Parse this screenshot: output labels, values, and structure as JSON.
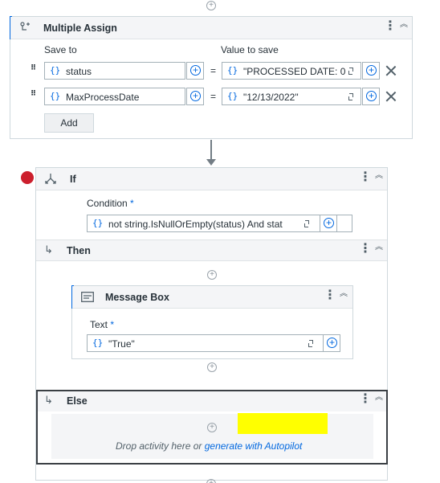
{
  "multiple_assign": {
    "title": "Multiple Assign",
    "save_to_label": "Save to",
    "value_to_save_label": "Value to save",
    "rows": [
      {
        "save_to": "status",
        "value": "\"PROCESSED DATE: 0!",
        "equals": "="
      },
      {
        "save_to": "MaxProcessDate",
        "value": "\"12/13/2022\"",
        "equals": "="
      }
    ],
    "add_label": "Add"
  },
  "if_activity": {
    "title": "If",
    "condition_label": "Condition",
    "required_mark": "*",
    "condition_value": "not string.IsNullOrEmpty(status)  And stat",
    "breakpoint_color": "#cc1f2d"
  },
  "then_branch": {
    "title": "Then",
    "message_box": {
      "title": "Message Box",
      "text_label": "Text",
      "required_mark": "*",
      "text_value": "\"True\""
    }
  },
  "else_branch": {
    "title": "Else",
    "drop_text": "Drop activity here or ",
    "autopilot_link": "generate with Autopilot",
    "highlight_color": "#ffff00"
  },
  "icons": {
    "brace": "{}",
    "kebab": "⋮",
    "collapse": "︽",
    "plus": "+"
  },
  "colors": {
    "accent_blue": "#0067df",
    "selected_border": "#3a3f44"
  }
}
